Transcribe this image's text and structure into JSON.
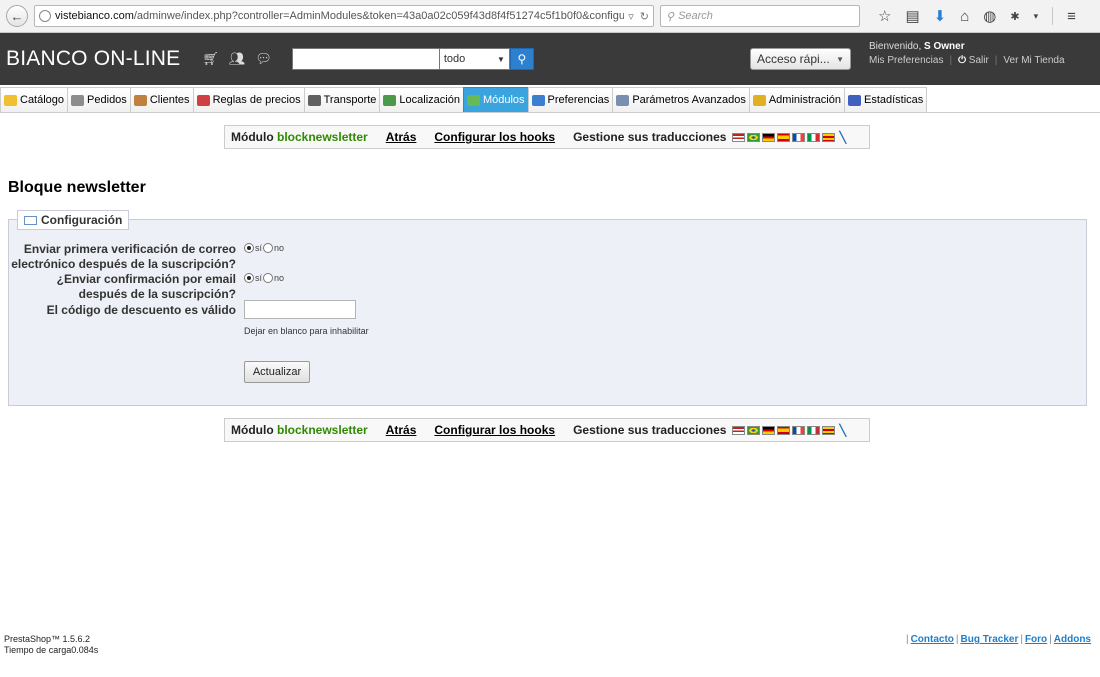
{
  "browser": {
    "url_domain": "vistebianco.com",
    "url_path": "/adminwe/index.php?controller=AdminModules&token=43a0a02c059f43d8f4f51274c5f1b0f0&configure=blo",
    "search_placeholder": "Search"
  },
  "header": {
    "shop_name": "BIANCO ON-LINE",
    "search_scope": "todo",
    "quick_access": "Acceso rápi...",
    "welcome_prefix": "Bienvenido,",
    "user_name": "S Owner",
    "links": {
      "preferences": "Mis Preferencias",
      "logout": "Salir",
      "view_shop": "Ver Mi Tienda"
    }
  },
  "tabs": [
    {
      "label": "Catálogo",
      "color": "#f0c030"
    },
    {
      "label": "Pedidos",
      "color": "#8c8c8c"
    },
    {
      "label": "Clientes",
      "color": "#c08040"
    },
    {
      "label": "Reglas de precios",
      "color": "#d04040"
    },
    {
      "label": "Transporte",
      "color": "#606060"
    },
    {
      "label": "Localización",
      "color": "#4a9a4a"
    },
    {
      "label": "Módulos",
      "color": "#66bb55"
    },
    {
      "label": "Preferencias",
      "color": "#3a7fd0"
    },
    {
      "label": "Parámetros Avanzados",
      "color": "#7a8fb0"
    },
    {
      "label": "Administración",
      "color": "#e0b020"
    },
    {
      "label": "Estadísticas",
      "color": "#4060c0"
    }
  ],
  "toolbar": {
    "module_prefix": "Módulo",
    "module_name": "blocknewsletter",
    "back": "Atrás",
    "hooks": "Configurar los hooks",
    "translations": "Gestione sus traducciones"
  },
  "page": {
    "title": "Bloque newsletter",
    "section_legend": "Configuración"
  },
  "form": {
    "q1_label": "Enviar primera verificación de correo electrónico después de la suscripción?",
    "q1_selected": "si",
    "q2_label": "¿Enviar confirmación por email después de la suscripción?",
    "q2_selected": "si",
    "radio_yes": "sí",
    "radio_no": "no",
    "voucher_label": "El código de descuento es válido",
    "voucher_value": "",
    "voucher_hint": "Dejar en blanco para inhabilitar",
    "submit_label": "Actualizar"
  },
  "footer": {
    "version": "PrestaShop™ 1.5.6.2",
    "load_time": "Tiempo de carga0.084s",
    "links": [
      "Contacto",
      "Bug Tracker",
      "Foro",
      "Addons"
    ]
  },
  "colors": {
    "header_bg": "#3a3a3a",
    "active_tab": "#39a4de",
    "module_name": "#2e8b00",
    "fieldset_bg": "#eef0f7",
    "footer_link": "#1f7ec9"
  }
}
